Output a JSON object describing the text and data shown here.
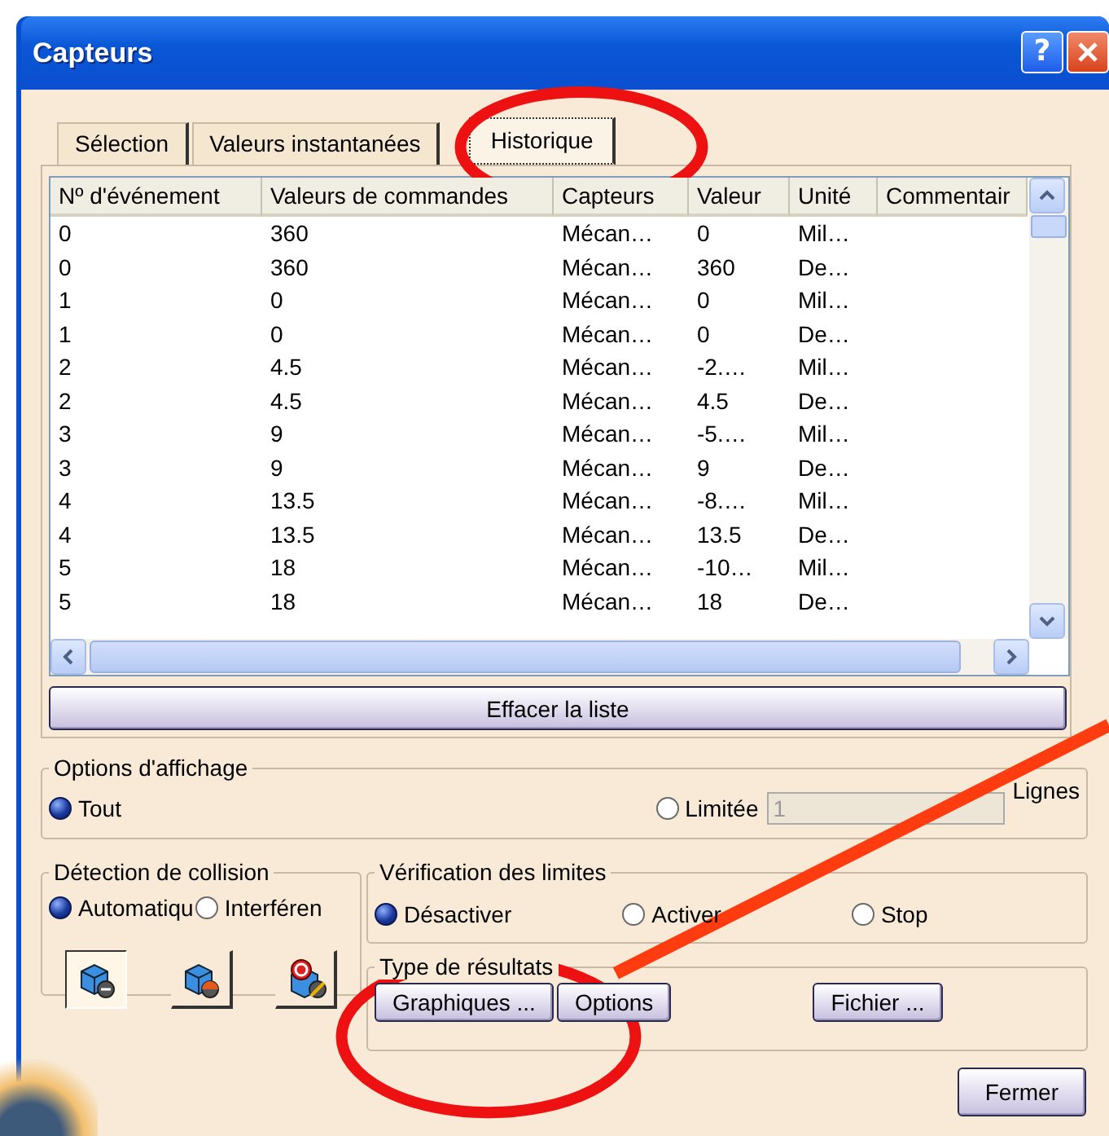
{
  "window": {
    "title": "Capteurs",
    "help_button": "?"
  },
  "tabs": [
    {
      "label": "Sélection",
      "selected": false
    },
    {
      "label": "Valeurs instantanées",
      "selected": false
    },
    {
      "label": "Historique",
      "selected": true
    }
  ],
  "table": {
    "columns": [
      "Nº d'événement",
      "Valeurs de commandes",
      "Capteurs",
      "Valeur",
      "Unité",
      "Commentair"
    ],
    "rows": [
      [
        "0",
        "360",
        "Mécan…",
        "0",
        "Mil…",
        ""
      ],
      [
        "0",
        "360",
        "Mécan…",
        "360",
        "De…",
        ""
      ],
      [
        "1",
        "0",
        "Mécan…",
        "0",
        "Mil…",
        ""
      ],
      [
        "1",
        "0",
        "Mécan…",
        "0",
        "De…",
        ""
      ],
      [
        "2",
        "4.5",
        "Mécan…",
        "-2.…",
        "Mil…",
        ""
      ],
      [
        "2",
        "4.5",
        "Mécan…",
        "4.5",
        "De…",
        ""
      ],
      [
        "3",
        "9",
        "Mécan…",
        "-5.…",
        "Mil…",
        ""
      ],
      [
        "3",
        "9",
        "Mécan…",
        "9",
        "De…",
        ""
      ],
      [
        "4",
        "13.5",
        "Mécan…",
        "-8.…",
        "Mil…",
        ""
      ],
      [
        "4",
        "13.5",
        "Mécan…",
        "13.5",
        "De…",
        ""
      ],
      [
        "5",
        "18",
        "Mécan…",
        "-10…",
        "Mil…",
        ""
      ],
      [
        "5",
        "18",
        "Mécan…",
        "18",
        "De…",
        ""
      ]
    ]
  },
  "clear_button": "Effacer la liste",
  "display_options": {
    "title": "Options d'affichage",
    "radios": [
      {
        "label": "Tout",
        "selected": true
      },
      {
        "label": "Limitée",
        "selected": false
      }
    ],
    "limit_field": {
      "value": "1",
      "disabled": true
    },
    "unit": "Lignes"
  },
  "collision": {
    "title": "Détection de collision",
    "radios": [
      {
        "label": "Automatiqu",
        "selected": true
      },
      {
        "label": "Interféren",
        "selected": false
      }
    ],
    "tools": [
      {
        "kind": "cube",
        "selected": true
      },
      {
        "kind": "cube-stop",
        "selected": false
      },
      {
        "kind": "stop-sign",
        "selected": false
      }
    ]
  },
  "limits": {
    "title": "Vérification des limites",
    "radios": [
      {
        "label": "Désactiver",
        "selected": true
      },
      {
        "label": "Activer",
        "selected": false
      },
      {
        "label": "Stop",
        "selected": false
      }
    ]
  },
  "results": {
    "title": "Type de résultats",
    "buttons": [
      "Graphiques ...",
      "Options",
      "Fichier ..."
    ]
  },
  "close_button": "Fermer",
  "annotations": [
    {
      "kind": "ellipse"
    },
    {
      "kind": "ellipse"
    },
    {
      "kind": "line"
    }
  ]
}
